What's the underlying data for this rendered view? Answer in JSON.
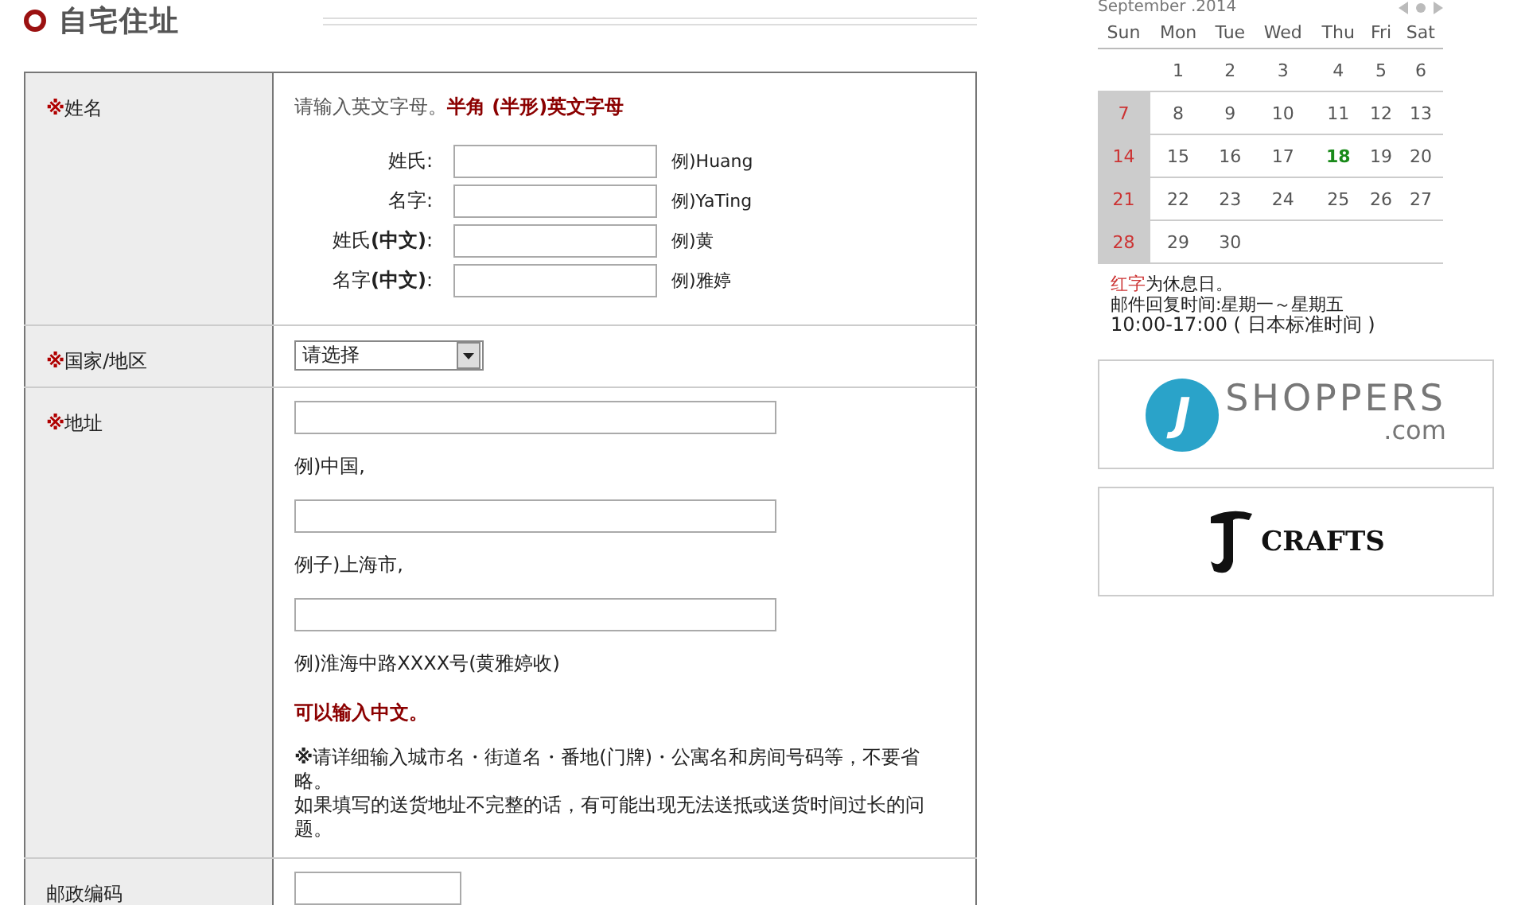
{
  "section": {
    "title": "自宅住址"
  },
  "form": {
    "name_row": {
      "mark": "※",
      "label": "姓名",
      "hint": "请输入英文字母。",
      "hint_emphasis": "半角 (半形)英文字母",
      "fields": [
        {
          "label": "姓氏:",
          "example": "例)Huang"
        },
        {
          "label": "名字:",
          "example": "例)YaTing"
        },
        {
          "label": "姓氏**(中文)**:",
          "example": "例)黄"
        },
        {
          "label": "名字**(中文)**:",
          "example": "例)雅婷"
        }
      ]
    },
    "country_row": {
      "mark": "※",
      "label": "国家/地区",
      "select": {
        "value": "请选择"
      }
    },
    "address_row": {
      "mark": "※",
      "label": "地址",
      "fields": [
        {
          "example": "例)中国,"
        },
        {
          "example": "例子)上海市,"
        },
        {
          "example": "例)淮海中路XXXX号(黄雅婷收)"
        }
      ],
      "note": "可以输入中文。",
      "details": [
        "**※**请详细输入城市名・街道名・番地(门牌)・公寓名和房间号码等，不要省略。",
        "如果填写的送货地址不完整的话，有可能出现无法送抵或送货时间过长的问题。"
      ]
    },
    "postal_row": {
      "label": "邮政编码"
    }
  },
  "calendar": {
    "month": "September .2014",
    "weekdays": [
      "Sun",
      "Mon",
      "Tue",
      "Wed",
      "Thu",
      "Fri",
      "Sat"
    ],
    "weeks": [
      [
        {
          "kind": "blank"
        },
        {
          "kind": "day",
          "day": "1",
          "holiday": false,
          "today": false
        },
        {
          "kind": "day",
          "day": "2",
          "holiday": false,
          "today": false
        },
        {
          "kind": "day",
          "day": "3",
          "holiday": false,
          "today": false
        },
        {
          "kind": "day",
          "day": "4",
          "holiday": false,
          "today": false
        },
        {
          "kind": "day",
          "day": "5",
          "holiday": false,
          "today": false
        },
        {
          "kind": "day",
          "day": "6",
          "holiday": false,
          "today": false
        }
      ],
      [
        {
          "kind": "day",
          "day": "7",
          "holiday": true,
          "today": false
        },
        {
          "kind": "day",
          "day": "8",
          "holiday": false,
          "today": false
        },
        {
          "kind": "day",
          "day": "9",
          "holiday": false,
          "today": false
        },
        {
          "kind": "day",
          "day": "10",
          "holiday": false,
          "today": false
        },
        {
          "kind": "day",
          "day": "11",
          "holiday": false,
          "today": false
        },
        {
          "kind": "day",
          "day": "12",
          "holiday": false,
          "today": false
        },
        {
          "kind": "day",
          "day": "13",
          "holiday": false,
          "today": false
        }
      ],
      [
        {
          "kind": "day",
          "day": "14",
          "holiday": true,
          "today": false
        },
        {
          "kind": "day",
          "day": "15",
          "holiday": false,
          "today": false
        },
        {
          "kind": "day",
          "day": "16",
          "holiday": false,
          "today": false
        },
        {
          "kind": "day",
          "day": "17",
          "holiday": false,
          "today": false
        },
        {
          "kind": "day",
          "day": "18",
          "holiday": false,
          "today": true
        },
        {
          "kind": "day",
          "day": "19",
          "holiday": false,
          "today": false
        },
        {
          "kind": "day",
          "day": "20",
          "holiday": false,
          "today": false
        }
      ],
      [
        {
          "kind": "day",
          "day": "21",
          "holiday": true,
          "today": false
        },
        {
          "kind": "day",
          "day": "22",
          "holiday": false,
          "today": false
        },
        {
          "kind": "day",
          "day": "23",
          "holiday": false,
          "today": false
        },
        {
          "kind": "day",
          "day": "24",
          "holiday": false,
          "today": false
        },
        {
          "kind": "day",
          "day": "25",
          "holiday": false,
          "today": false
        },
        {
          "kind": "day",
          "day": "26",
          "holiday": false,
          "today": false
        },
        {
          "kind": "day",
          "day": "27",
          "holiday": false,
          "today": false
        }
      ],
      [
        {
          "kind": "day",
          "day": "28",
          "holiday": true,
          "today": false
        },
        {
          "kind": "day",
          "day": "29",
          "holiday": false,
          "today": false
        },
        {
          "kind": "day",
          "day": "30",
          "holiday": false,
          "today": false
        },
        {
          "kind": "blank"
        },
        {
          "kind": "blank"
        },
        {
          "kind": "blank"
        },
        {
          "kind": "blank"
        }
      ]
    ],
    "legend_red": "红字",
    "legend_rest": "为休息日。",
    "hours": "邮件回复时间:星期一～星期五",
    "hours_time": "10:00-17:00 ( 日本标准时间 )"
  },
  "banners": [
    {
      "kind": "shoppers",
      "letter": "J",
      "name": "SHOPPERS",
      "suffix": ".com"
    },
    {
      "kind": "crafts",
      "name": "CRAFTS"
    }
  ]
}
